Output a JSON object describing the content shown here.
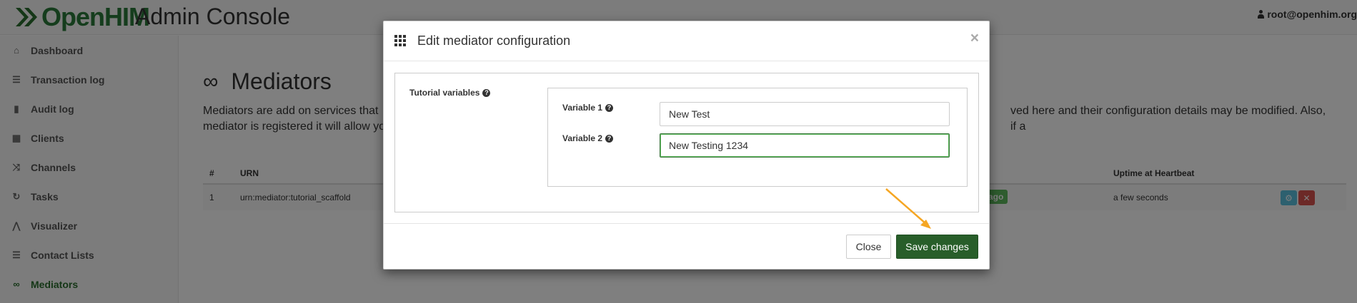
{
  "app": {
    "logo_text": "OpenHIM",
    "title": "Admin Console",
    "user": "root@openhim.org"
  },
  "sidebar": {
    "items": [
      {
        "label": "Dashboard",
        "icon": "home-icon"
      },
      {
        "label": "Transaction log",
        "icon": "list-icon"
      },
      {
        "label": "Audit log",
        "icon": "book-icon"
      },
      {
        "label": "Clients",
        "icon": "grid-icon"
      },
      {
        "label": "Channels",
        "icon": "random-icon"
      },
      {
        "label": "Tasks",
        "icon": "refresh-icon"
      },
      {
        "label": "Visualizer",
        "icon": "road-icon"
      },
      {
        "label": "Contact Lists",
        "icon": "list-icon"
      },
      {
        "label": "Mediators",
        "icon": "link-icon",
        "active": true
      }
    ]
  },
  "page": {
    "heading": "Mediators",
    "desc_left": "Mediators are add on services that",
    "desc_right": "ved here and their configuration details may be modified. Also, if a",
    "desc_line2": "mediator is registered it will allow yo",
    "table": {
      "headers": {
        "num": "#",
        "urn": "URN",
        "uptime": "Uptime at Heartbeat"
      },
      "row": {
        "num": "1",
        "urn": "urn:mediator:tutorial_scaffold",
        "badge": "ago",
        "uptime": "a few seconds"
      }
    }
  },
  "modal": {
    "title": "Edit mediator configuration",
    "close_symbol": "×",
    "section_label": "Tutorial variables",
    "fields": [
      {
        "label": "Variable 1",
        "value": "New Test"
      },
      {
        "label": "Variable 2",
        "value": "New Testing 1234"
      }
    ],
    "close_button": "Close",
    "save_button": "Save changes"
  },
  "colors": {
    "accent": "#285e2a",
    "annotation_arrow": "#f5a623"
  }
}
